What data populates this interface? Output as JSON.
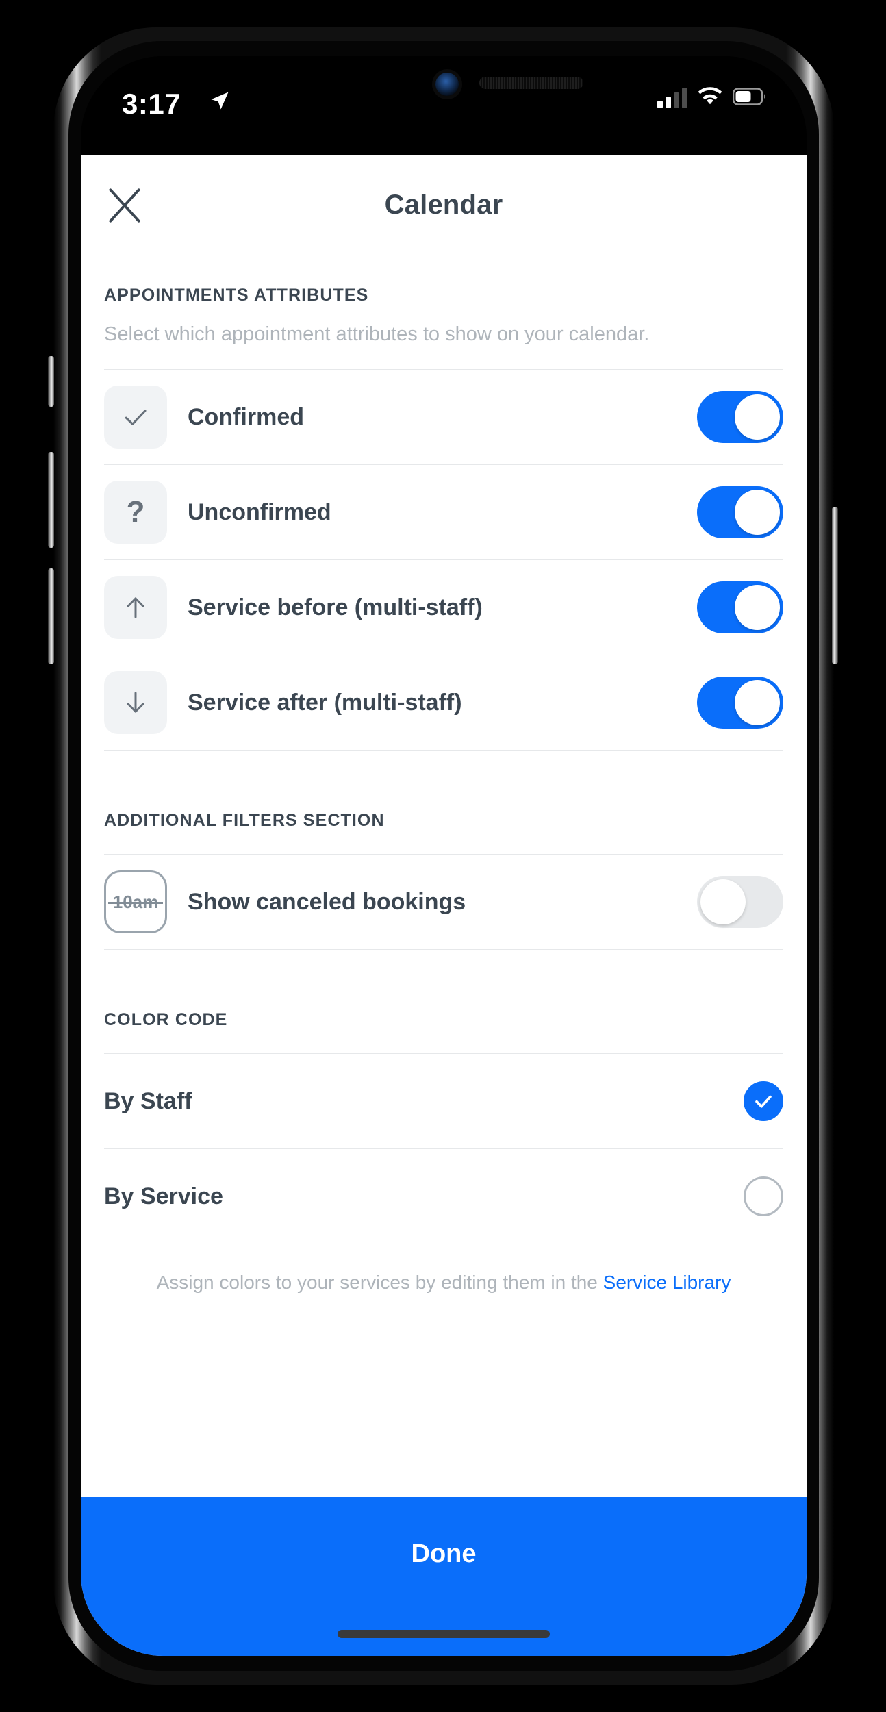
{
  "status_bar": {
    "time": "3:17",
    "location_icon": "location-arrow-icon",
    "signal_icon": "cellular-signal-icon",
    "signal_bars_filled": 2,
    "signal_bars_total": 4,
    "wifi_icon": "wifi-icon",
    "battery_icon": "battery-icon",
    "battery_level_percent": 60
  },
  "header": {
    "title": "Calendar",
    "close_icon": "close-x-icon"
  },
  "appointments_section": {
    "title": "APPOINTMENTS ATTRIBUTES",
    "description": "Select which appointment attributes to show on your calendar.",
    "rows": [
      {
        "label": "Confirmed",
        "icon": "checkmark-icon",
        "glyph": "check",
        "toggle": "on"
      },
      {
        "label": "Unconfirmed",
        "icon": "question-mark-icon",
        "glyph": "?",
        "toggle": "on"
      },
      {
        "label": "Service before (multi-staff)",
        "icon": "arrow-up-icon",
        "glyph": "up",
        "toggle": "on"
      },
      {
        "label": "Service after (multi-staff)",
        "icon": "arrow-down-icon",
        "glyph": "down",
        "toggle": "on"
      }
    ]
  },
  "filters_section": {
    "title": "ADDITIONAL FILTERS SECTION",
    "rows": [
      {
        "label": "Show canceled bookings",
        "icon": "canceled-time-icon",
        "glyph": "10am",
        "toggle": "off"
      }
    ]
  },
  "color_code_section": {
    "title": "COLOR CODE",
    "options": [
      {
        "label": "By Staff",
        "selected": true
      },
      {
        "label": "By Service",
        "selected": false
      }
    ],
    "footnote_text": "Assign colors to your services by editing them in the ",
    "footnote_link": "Service Library"
  },
  "footer": {
    "done_label": "Done"
  },
  "colors": {
    "accent_blue": "#0A6EFA",
    "toggle_off": "#E7E9EB",
    "text_dark": "#3B4651",
    "text_muted": "#AEB4BA",
    "divider": "#E6E8EA",
    "icon_bg": "#F1F3F5"
  }
}
